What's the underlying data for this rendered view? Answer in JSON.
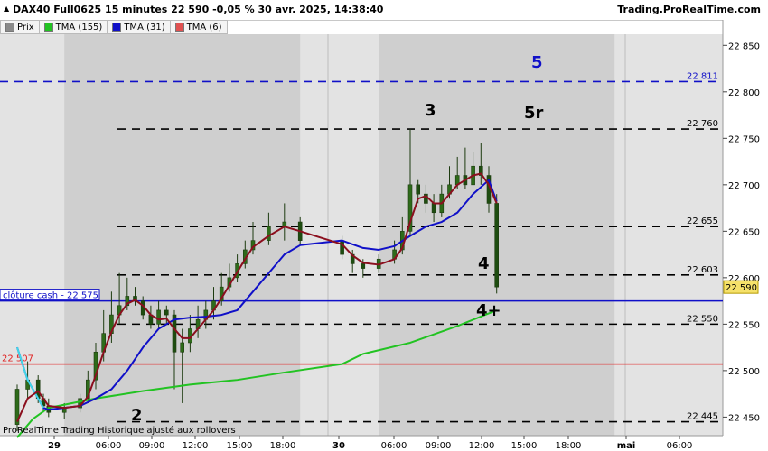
{
  "header": {
    "title": "DAX40 Full0625 15 minutes 22 590 -0,05 % 30 avr. 2025, 14:38:40",
    "brand": "Trading.ProRealTime.com"
  },
  "legend": [
    {
      "label": "Prix",
      "color": "#8a8a8a"
    },
    {
      "label": "TMA (155)",
      "color": "#22c322"
    },
    {
      "label": "TMA (31)",
      "color": "#1010c8"
    },
    {
      "label": "TMA (6)",
      "color": "#e05050"
    }
  ],
  "footer": "ProRealTime Trading  Historique ajusté aux rollovers",
  "colors": {
    "price_up": "#2e6b1a",
    "price_down": "#1e4d10",
    "tma155": "#22c322",
    "tma31": "#1010c8",
    "tma6_up": "#e06a78",
    "tma6_down": "#8b0f1e",
    "support_red": "#e02020",
    "cash_close_blue": "#1010c8",
    "dashed_black": "#000000",
    "dashed_blue": "#1010c8",
    "cyan": "#40d8e8"
  },
  "chart_data": {
    "type": "line",
    "title": "DAX40 Full0625 15 minutes",
    "ylim": [
      22430,
      22860
    ],
    "y_ticks": [
      22450,
      22500,
      22550,
      22600,
      22650,
      22700,
      22750,
      22800,
      22850
    ],
    "y_tick_labels": [
      "22 450",
      "22 500",
      "22 550",
      "22 600",
      "22 650",
      "22 700",
      "22 750",
      "22 800",
      "22 850"
    ],
    "x_ticks": [
      "29",
      "06:00",
      "09:00",
      "12:00",
      "15:00",
      "18:00",
      "30",
      "06:00",
      "09:00",
      "12:00",
      "15:00",
      "18:00",
      "mai",
      "06:00"
    ],
    "levels": [
      {
        "value": 22811,
        "label": "22 811",
        "style": "dashed-blue",
        "tag": "5"
      },
      {
        "value": 22760,
        "label": "22 760",
        "style": "dashed-black",
        "tag": "5r"
      },
      {
        "value": 22655,
        "label": "22 655",
        "style": "dashed-black",
        "tag": ""
      },
      {
        "value": 22603,
        "label": "22 603",
        "style": "dashed-black",
        "tag": "4"
      },
      {
        "value": 22550,
        "label": "22 550",
        "style": "dashed-black",
        "tag": "4+"
      },
      {
        "value": 22445,
        "label": "22 445",
        "style": "dashed-black",
        "tag": "2"
      },
      {
        "value": 22575,
        "label": "clôture cash -  22 575",
        "style": "solid-blue",
        "tag": ""
      },
      {
        "value": 22507,
        "label": "22 507",
        "style": "solid-red",
        "tag": ""
      }
    ],
    "current_price": {
      "value": 22590,
      "label": "22 590"
    },
    "annotations": [
      {
        "text": "3",
        "x": "09:00 (30)",
        "y": 22756
      },
      {
        "text": "5",
        "y": 22811
      },
      {
        "text": "5r",
        "y": 22760
      },
      {
        "text": "4",
        "y": 22603
      },
      {
        "text": "4+",
        "y": 22550
      },
      {
        "text": "2",
        "y": 22445
      }
    ],
    "series": [
      {
        "name": "Prix",
        "type": "ohlc",
        "x": [
          "29 00:00",
          "29 02:00",
          "29 04:00",
          "29 05:00",
          "29 06:00",
          "29 07:00",
          "29 08:00",
          "29 08:30",
          "29 09:00",
          "29 09:30",
          "29 10:00",
          "29 10:30",
          "29 11:00",
          "29 11:30",
          "29 12:00",
          "29 12:30",
          "29 13:00",
          "29 13:30",
          "29 14:00",
          "29 14:30",
          "29 15:00",
          "29 15:30",
          "29 16:00",
          "29 16:30",
          "29 17:00",
          "29 17:30",
          "29 18:00",
          "29 18:30",
          "29 19:00",
          "29 20:00",
          "29 21:00",
          "29 22:00",
          "30 02:00",
          "30 04:00",
          "30 06:00",
          "30 07:00",
          "30 08:00",
          "30 08:30",
          "30 09:00",
          "30 09:30",
          "30 10:00",
          "30 10:30",
          "30 11:00",
          "30 11:30",
          "30 12:00",
          "30 12:30",
          "30 13:00",
          "30 13:30",
          "30 14:00",
          "30 14:30"
        ],
        "open": [
          22442,
          22480,
          22490,
          22470,
          22462,
          22455,
          22460,
          22470,
          22490,
          22520,
          22540,
          22560,
          22570,
          22580,
          22575,
          22560,
          22550,
          22565,
          22560,
          22520,
          22530,
          22545,
          22555,
          22565,
          22575,
          22590,
          22600,
          22615,
          22630,
          22640,
          22655,
          22660,
          22640,
          22625,
          22615,
          22610,
          22620,
          22630,
          22650,
          22700,
          22690,
          22680,
          22670,
          22690,
          22700,
          22710,
          22700,
          22720,
          22710,
          22680
        ],
        "close": [
          22480,
          22490,
          22470,
          22462,
          22455,
          22460,
          22470,
          22490,
          22520,
          22540,
          22560,
          22570,
          22580,
          22575,
          22560,
          22550,
          22565,
          22560,
          22520,
          22530,
          22545,
          22555,
          22565,
          22575,
          22590,
          22600,
          22615,
          22630,
          22640,
          22655,
          22660,
          22640,
          22625,
          22615,
          22610,
          22620,
          22630,
          22650,
          22700,
          22690,
          22680,
          22670,
          22690,
          22700,
          22710,
          22700,
          22720,
          22710,
          22680,
          22590
        ],
        "high": [
          22485,
          22510,
          22495,
          22475,
          22470,
          22465,
          22475,
          22500,
          22530,
          22565,
          22585,
          22605,
          22600,
          22590,
          22580,
          22570,
          22575,
          22570,
          22565,
          22545,
          22560,
          22570,
          22575,
          22590,
          22605,
          22615,
          22625,
          22640,
          22660,
          22670,
          22680,
          22665,
          22645,
          22630,
          22620,
          22625,
          22640,
          22665,
          22760,
          22705,
          22700,
          22690,
          22700,
          22720,
          22730,
          22740,
          22735,
          22745,
          22720,
          22690
        ],
        "low": [
          22435,
          22470,
          22465,
          22455,
          22450,
          22448,
          22455,
          22465,
          22480,
          22510,
          22530,
          22550,
          22565,
          22570,
          22555,
          22545,
          22545,
          22550,
          22480,
          22465,
          22520,
          22535,
          22545,
          22555,
          22570,
          22585,
          22595,
          22610,
          22625,
          22635,
          22640,
          22635,
          22620,
          22605,
          22600,
          22605,
          22615,
          22625,
          22645,
          22680,
          22670,
          22660,
          22665,
          22685,
          22695,
          22695,
          22700,
          22700,
          22670,
          22583
        ]
      },
      {
        "name": "TMA (6)",
        "x": [
          "29 00:00",
          "29 02:00",
          "29 04:00",
          "29 05:00",
          "29 06:00",
          "29 07:00",
          "29 08:00",
          "29 08:30",
          "29 09:00",
          "29 09:30",
          "29 10:00",
          "29 10:30",
          "29 11:00",
          "29 11:30",
          "29 12:00",
          "29 12:30",
          "29 13:00",
          "29 13:30",
          "29 14:00",
          "29 14:30",
          "29 15:00",
          "29 15:30",
          "29 16:00",
          "29 16:30",
          "29 17:00",
          "29 17:30",
          "29 18:00",
          "29 18:30",
          "29 19:00",
          "29 20:00",
          "29 21:00",
          "29 22:00",
          "30 02:00",
          "30 04:00",
          "30 06:00",
          "30 07:00",
          "30 08:00",
          "30 08:30",
          "30 09:00",
          "30 09:30",
          "30 10:00",
          "30 10:30",
          "30 11:00",
          "30 11:30",
          "30 12:00",
          "30 12:30",
          "30 13:00",
          "30 13:30",
          "30 14:00",
          "30 14:30"
        ],
        "values": [
          22445,
          22470,
          22478,
          22470,
          22462,
          22460,
          22462,
          22472,
          22495,
          22520,
          22542,
          22560,
          22572,
          22576,
          22570,
          22560,
          22555,
          22556,
          22545,
          22535,
          22535,
          22545,
          22555,
          22565,
          22578,
          22592,
          22606,
          22620,
          22633,
          22645,
          22655,
          22650,
          22636,
          22624,
          22616,
          22614,
          22620,
          22632,
          22660,
          22685,
          22688,
          22680,
          22680,
          22690,
          22700,
          22705,
          22710,
          22712,
          22700,
          22680
        ]
      },
      {
        "name": "TMA (31)",
        "x": [
          "29 00:00",
          "29 02:00",
          "29 04:00",
          "29 05:00",
          "29 06:00",
          "29 07:00",
          "29 08:00",
          "29 09:00",
          "29 10:00",
          "29 11:00",
          "29 12:00",
          "29 13:00",
          "29 14:00",
          "29 15:00",
          "29 16:00",
          "29 17:00",
          "29 18:00",
          "29 19:00",
          "29 20:00",
          "29 21:00",
          "29 22:00",
          "30 02:00",
          "30 06:00",
          "30 07:00",
          "30 08:00",
          "30 09:00",
          "30 10:00",
          "30 11:00",
          "30 12:00",
          "30 13:00",
          "30 14:00",
          "30 14:30"
        ],
        "values": [
          22525,
          22490,
          22470,
          22460,
          22458,
          22460,
          22462,
          22470,
          22480,
          22500,
          22525,
          22545,
          22555,
          22557,
          22558,
          22560,
          22565,
          22585,
          22605,
          22625,
          22635,
          22640,
          22632,
          22630,
          22634,
          22645,
          22655,
          22660,
          22670,
          22690,
          22705,
          22682
        ]
      },
      {
        "name": "TMA (155)",
        "x": [
          "29 00:00",
          "29 03:00",
          "29 06:00",
          "29 09:00",
          "29 12:00",
          "29 15:00",
          "29 18:00",
          "29 21:00",
          "30 02:00",
          "30 06:00",
          "30 09:00",
          "30 12:00",
          "30 14:30"
        ],
        "values": [
          22428,
          22448,
          22460,
          22470,
          22478,
          22485,
          22490,
          22498,
          22507,
          22518,
          22530,
          22548,
          22565
        ]
      }
    ]
  }
}
